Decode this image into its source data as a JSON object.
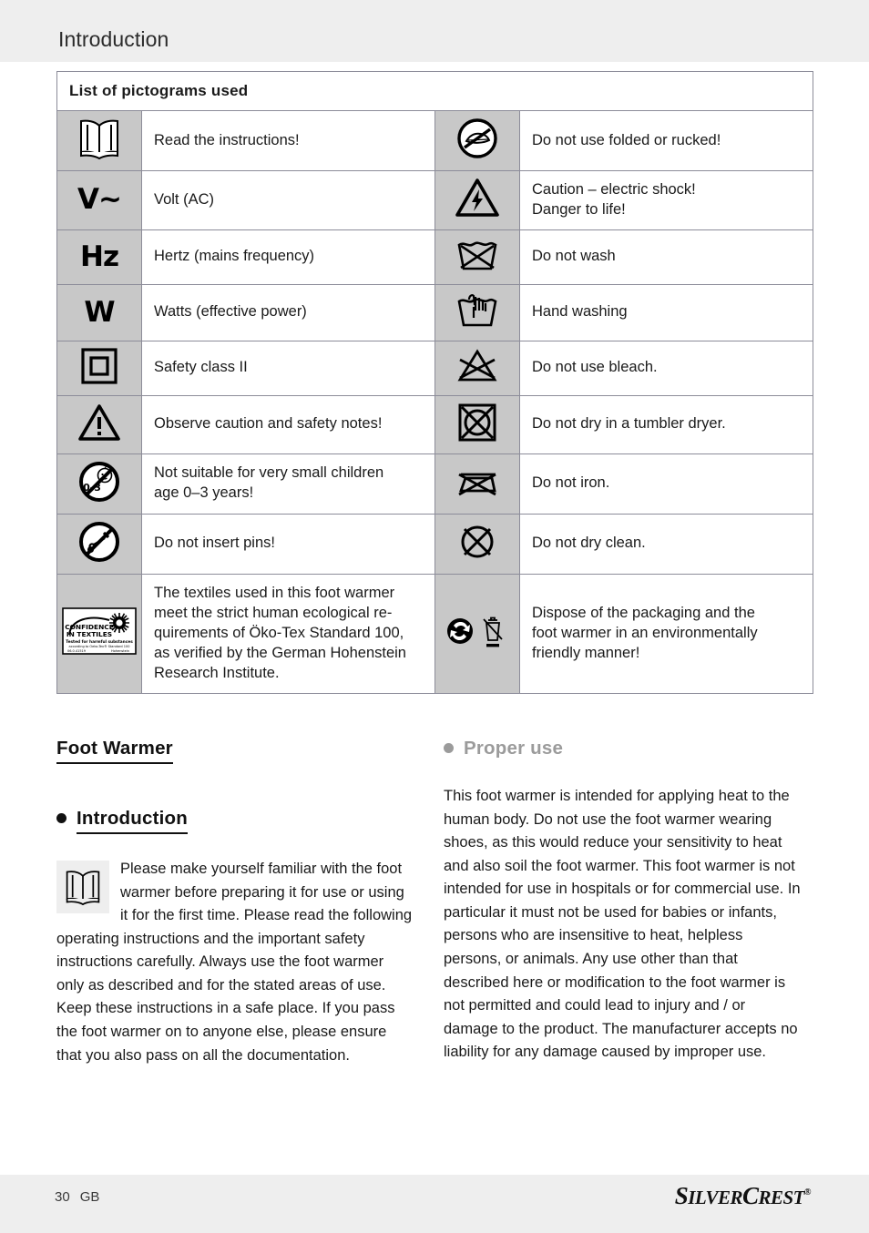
{
  "header": {
    "title": "Introduction"
  },
  "table": {
    "caption": "List of pictograms used",
    "rows": [
      {
        "left_icon": "open-book-icon",
        "left_text": [
          "Read the instructions!"
        ],
        "right_icon": "no-folded-rucked-icon",
        "right_text": [
          "Do not use folded or rucked!"
        ]
      },
      {
        "left_icon": "volt-ac-symbol",
        "left_glyph": "V~",
        "left_text": [
          "Volt (AC)"
        ],
        "right_icon": "electric-shock-warning-icon",
        "right_text": [
          "Caution – electric shock!",
          "Danger to life!"
        ]
      },
      {
        "left_icon": "hertz-symbol",
        "left_glyph": "Hz",
        "left_text": [
          "Hertz (mains frequency)"
        ],
        "right_icon": "do-not-wash-icon",
        "right_text": [
          "Do not wash"
        ]
      },
      {
        "left_icon": "watt-symbol",
        "left_glyph": "W",
        "left_text": [
          "Watts (effective power)"
        ],
        "right_icon": "hand-washing-icon",
        "right_text": [
          "Hand washing"
        ]
      },
      {
        "left_icon": "safety-class-2-icon",
        "left_text": [
          "Safety class II"
        ],
        "right_icon": "do-not-bleach-icon",
        "right_text": [
          "Do not use bleach."
        ]
      },
      {
        "left_icon": "warning-triangle-icon",
        "left_text": [
          "Observe caution and safety notes!"
        ],
        "right_icon": "no-tumble-dry-icon",
        "right_text": [
          "Do not dry in a tumbler dryer."
        ]
      },
      {
        "left_icon": "no-small-children-icon",
        "left_text": [
          "Not suitable for very small children",
          "age 0–3 years!"
        ],
        "right_icon": "do-not-iron-icon",
        "right_text": [
          "Do not iron."
        ]
      },
      {
        "left_icon": "no-pins-icon",
        "left_text": [
          "Do not insert pins!"
        ],
        "right_icon": "no-dry-clean-icon",
        "right_text": [
          "Do not dry clean."
        ]
      },
      {
        "left_icon": "oeko-tex-confidence-in-textiles-icon",
        "left_text": [
          "The textiles used in this foot warmer",
          "meet the strict human ecological re-",
          "quirements of Öko-Tex Standard 100,",
          "as verified by the German Hohenstein",
          "Research Institute."
        ],
        "right_icon": "recycling-disposal-icon",
        "right_text": [
          "Dispose of the packaging and the",
          "foot warmer in an environmentally",
          "friendly manner!"
        ]
      }
    ]
  },
  "oeko_tex_logo": {
    "line1": "CONFIDENCE",
    "line2": "IN TEXTILES",
    "line3": "Tested for harmful substances",
    "line4": "according to Oeko-Tex® Standard 100",
    "line5": "06.0.41519",
    "line6": "Hohenstein"
  },
  "content": {
    "product_heading": "Foot Warmer",
    "intro": {
      "heading": "Introduction",
      "icon": "open-book-icon",
      "paragraph": "Please make yourself familiar with the foot warmer before preparing it for use or using it for the first time. Please read the following operating instructions and the important safety instructions carefully. Always use the foot warmer only as described and for the stated areas of use. Keep these instructions in a safe place. If you pass the foot warmer on to anyone else, please ensure that you also pass on all the documentation."
    },
    "proper_use": {
      "heading": "Proper use",
      "paragraph": "This foot warmer is intended for applying heat to the human body. Do not use the foot warmer wearing shoes, as this would reduce your sensitivity to heat and also soil the foot warmer. This foot warmer is not intended for use in hospitals or for commercial use. In particular it must not be used for babies or infants, persons who are insensitive to heat, helpless persons, or animals. Any use other than that described here or modification to the foot warmer is not permitted and could lead to injury and / or damage to the product. The manufacturer accepts no liability for any damage caused by improper use."
    }
  },
  "footer": {
    "page_number": "30",
    "language_code": "GB",
    "brand_part1": "S",
    "brand_part2": "ILVER",
    "brand_part3": "C",
    "brand_part4": "REST",
    "brand_mark": "®"
  },
  "colors": {
    "band": "#eeeeee",
    "icon_cell": "#c8c8c8",
    "border": "#8c8c99",
    "gray_heading": "#9b9b9b"
  }
}
